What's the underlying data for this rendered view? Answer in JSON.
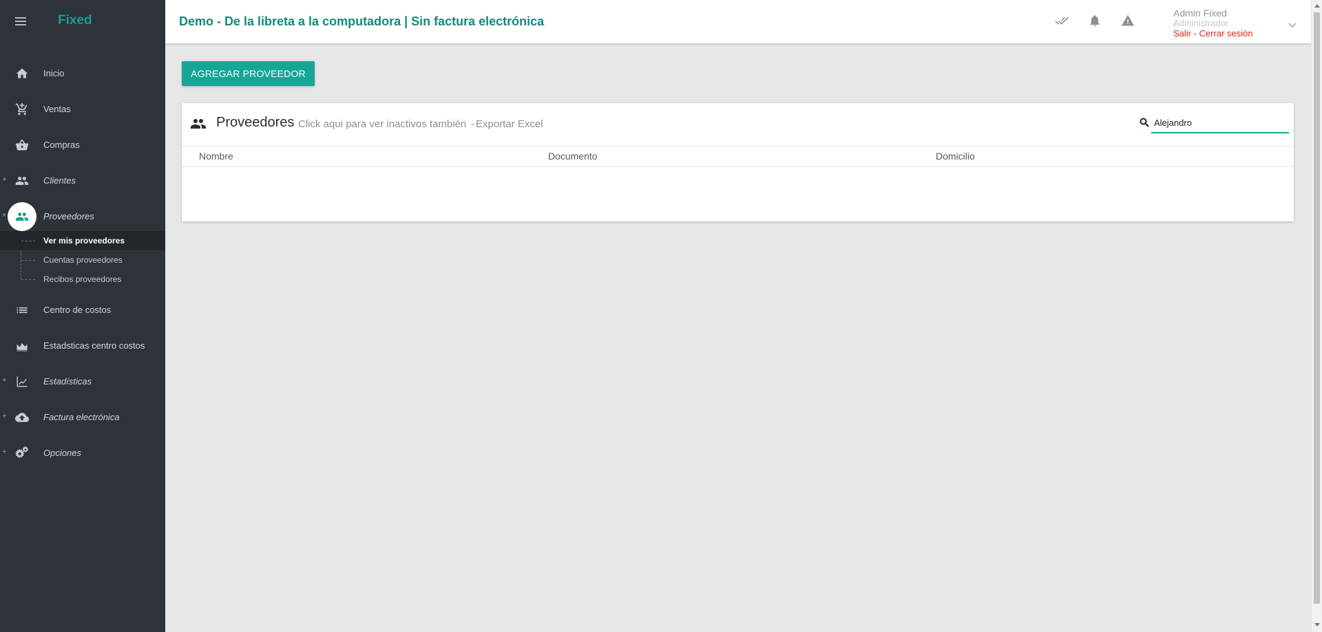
{
  "brand": "Fixed",
  "header": {
    "title": "Demo - De la libreta a la computadora | Sin factura electrónica",
    "user_name": "Admin Fixed",
    "user_role": "Administrador",
    "logout": "Salir - Cerrar sesión"
  },
  "sidebar": {
    "items": [
      {
        "label": "Inicio",
        "icon": "home-icon",
        "expand": ""
      },
      {
        "label": "Ventas",
        "icon": "cart-icon",
        "expand": ""
      },
      {
        "label": "Compras",
        "icon": "basket-icon",
        "expand": ""
      },
      {
        "label": "Clientes",
        "icon": "people-icon",
        "expand": "+"
      },
      {
        "label": "Proveedores",
        "icon": "people-icon",
        "expand": "×"
      },
      {
        "label": "Centro de costos",
        "icon": "list-icon",
        "expand": ""
      },
      {
        "label": "Estadsticas centro costos",
        "icon": "area-chart-icon",
        "expand": ""
      },
      {
        "label": "Estadísticas",
        "icon": "line-chart-icon",
        "expand": "+"
      },
      {
        "label": "Factura electrónica",
        "icon": "cloud-upload-icon",
        "expand": "+"
      },
      {
        "label": "Opciones",
        "icon": "gears-icon",
        "expand": "+"
      }
    ],
    "subitems": [
      {
        "label": "Ver mis proveedores"
      },
      {
        "label": "Cuentas proveedores"
      },
      {
        "label": "Recibos proveedores"
      }
    ]
  },
  "main": {
    "add_button": "AGREGAR PROVEEDOR",
    "card_title": "Proveedores",
    "link_inactive": "Click aqui para ver inactivos también",
    "link_sep": " - ",
    "link_export": "Exportar Excel",
    "search_value": "Alejandro",
    "columns": [
      "Nombre",
      "Documento",
      "Domicilio"
    ]
  },
  "colors": {
    "accent": "#17a596",
    "sidebar_bg": "#2d3339",
    "logout": "#e5231a"
  }
}
